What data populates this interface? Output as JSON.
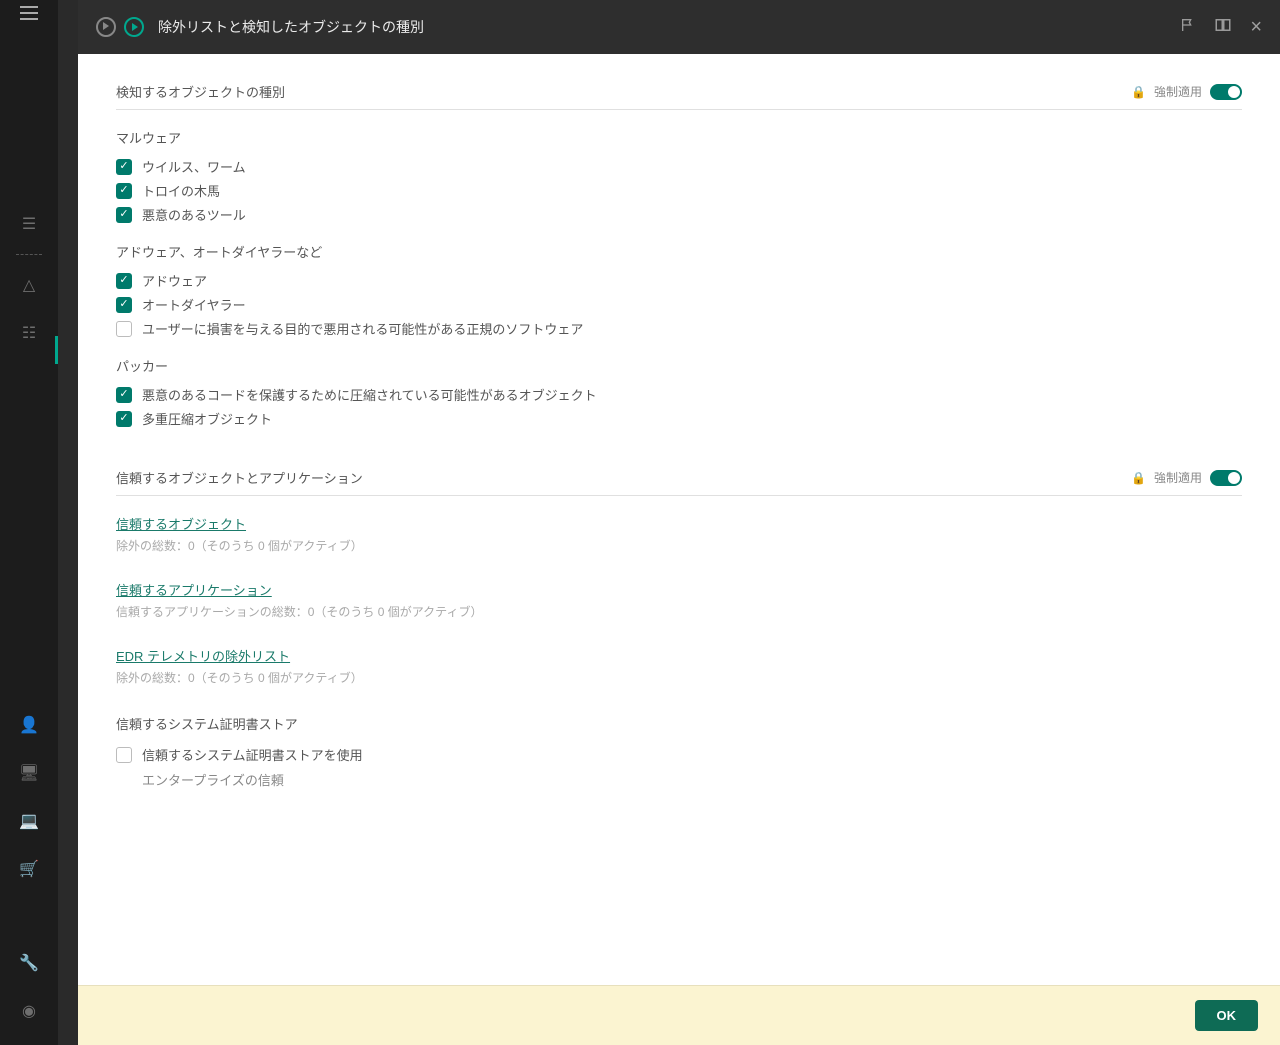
{
  "rail": {
    "icons": {
      "menu": "menu",
      "layers": "layers",
      "warning": "warning",
      "tree": "tree",
      "user": "user",
      "server": "server",
      "monitor": "monitor",
      "basket": "basket",
      "wrench": "wrench",
      "account": "account"
    }
  },
  "header": {
    "title": "除外リストと検知したオブジェクトの種別",
    "flag": "flag",
    "book": "book",
    "close": "×"
  },
  "section1": {
    "title": "検知するオブジェクトの種別",
    "enforce_label": "強制適用",
    "malware_title": "マルウェア",
    "malware_items": [
      {
        "label": "ウイルス、ワーム",
        "checked": true
      },
      {
        "label": "トロイの木馬",
        "checked": true
      },
      {
        "label": "悪意のあるツール",
        "checked": true
      }
    ],
    "adware_title": "アドウェア、オートダイヤラーなど",
    "adware_items": [
      {
        "label": "アドウェア",
        "checked": true
      },
      {
        "label": "オートダイヤラー",
        "checked": true
      },
      {
        "label": "ユーザーに損害を与える目的で悪用される可能性がある正規のソフトウェア",
        "checked": false
      }
    ],
    "packer_title": "パッカー",
    "packer_items": [
      {
        "label": "悪意のあるコードを保護するために圧縮されている可能性があるオブジェクト",
        "checked": true
      },
      {
        "label": "多重圧縮オブジェクト",
        "checked": true
      }
    ]
  },
  "section2": {
    "title": "信頼するオブジェクトとアプリケーション",
    "enforce_label": "強制適用",
    "trusted_obj": {
      "link": "信頼するオブジェクト",
      "sub": "除外の総数：0（そのうち 0 個がアクティブ）"
    },
    "trusted_app": {
      "link": "信頼するアプリケーション",
      "sub": "信頼するアプリケーションの総数：0（そのうち 0 個がアクティブ）"
    },
    "edr": {
      "link": "EDR テレメトリの除外リスト",
      "sub": "除外の総数：0（そのうち 0 個がアクティブ）"
    },
    "cert_title": "信頼するシステム証明書ストア",
    "cert_check": {
      "label": "信頼するシステム証明書ストアを使用",
      "checked": false
    },
    "cert_sub": "エンタープライズの信頼"
  },
  "footer": {
    "ok": "OK"
  }
}
